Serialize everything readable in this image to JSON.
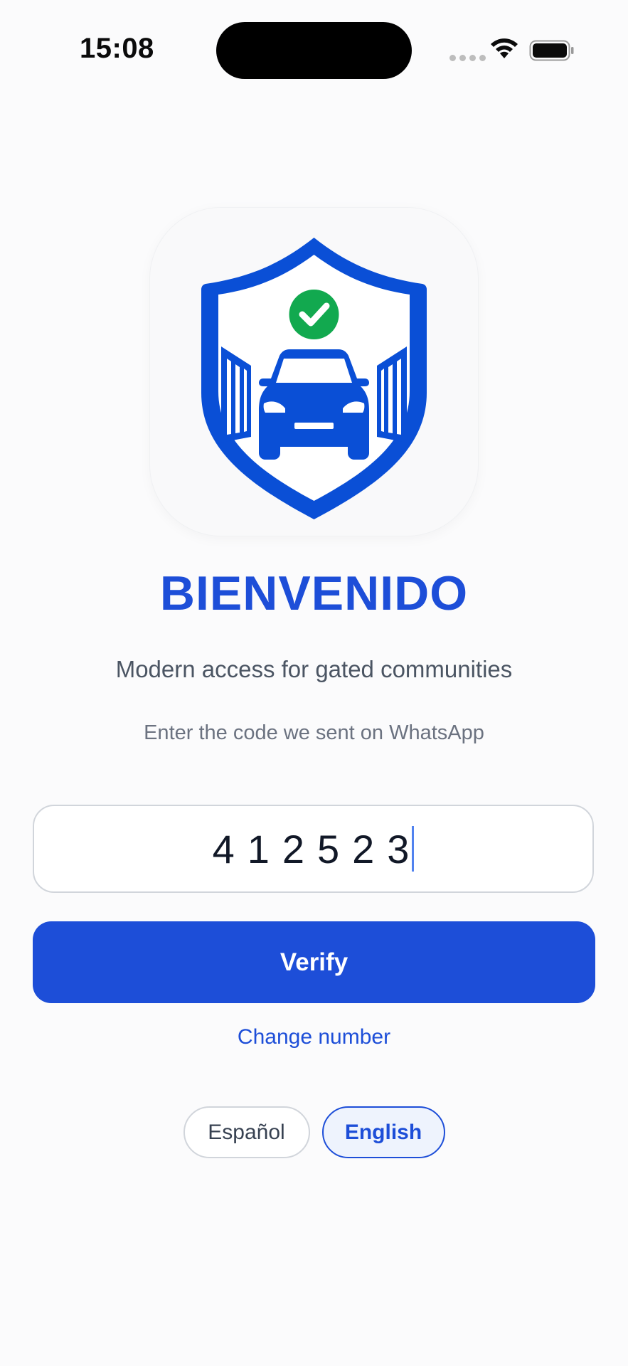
{
  "status_bar": {
    "time": "15:08",
    "icons": [
      "signal-dots-icon",
      "wifi-icon",
      "battery-icon"
    ]
  },
  "app_icon": {
    "name": "shield-car-gate-logo",
    "colors": {
      "shield": "#0a4fd6",
      "check_badge": "#12a94f",
      "background": "#f9f9fa"
    }
  },
  "welcome": {
    "title": "BIENVENIDO",
    "subtitle": "Modern access for gated communities",
    "instruction": "Enter the code we sent on WhatsApp"
  },
  "code_field": {
    "value": "412523"
  },
  "actions": {
    "verify_label": "Verify",
    "change_number_label": "Change number"
  },
  "language": {
    "options": [
      "Español",
      "English"
    ],
    "selected": "English"
  },
  "colors": {
    "primary": "#1d4ed8",
    "text_secondary": "#4b5563",
    "text_muted": "#6b7280",
    "border": "#d1d5db"
  }
}
